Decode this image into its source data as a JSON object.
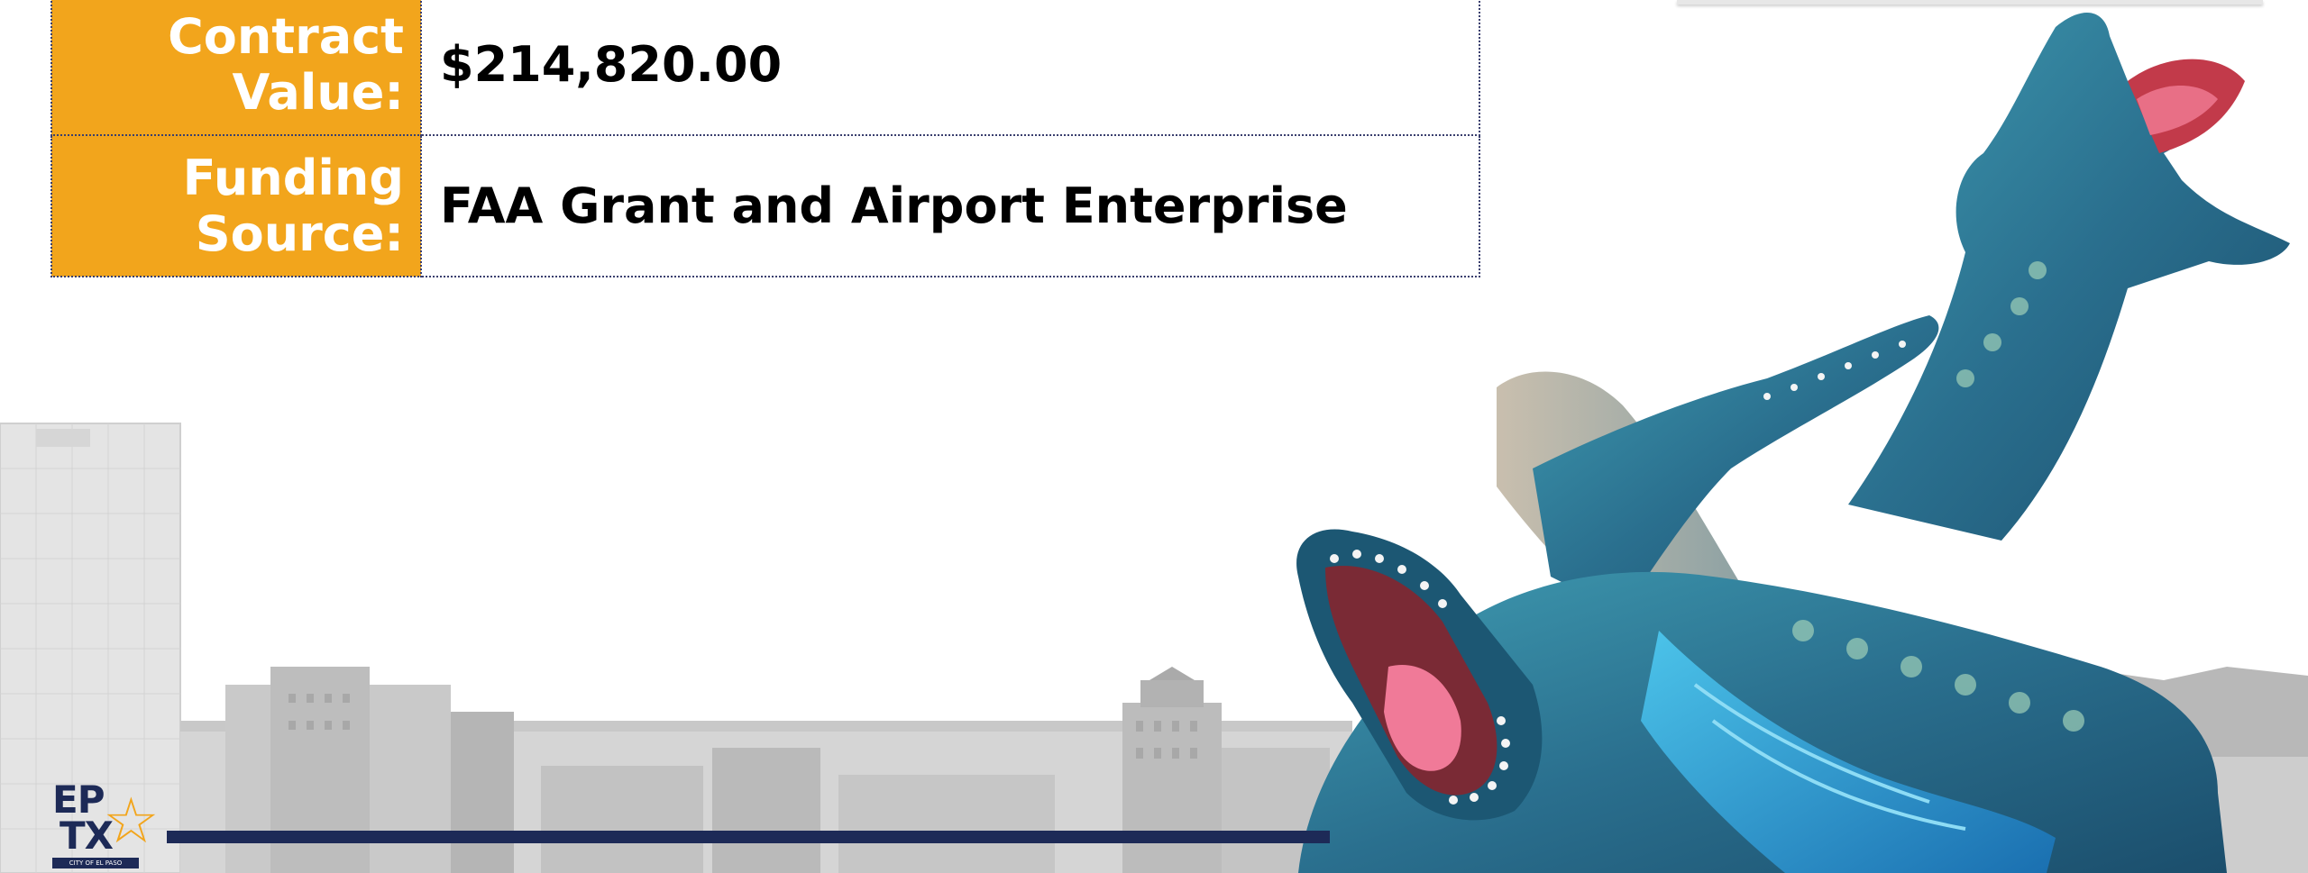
{
  "table": {
    "rows": [
      {
        "label_line1": "Contract",
        "label_line2": "Value:",
        "value": "$214,820.00"
      },
      {
        "label_line1": "Funding",
        "label_line2": "Source:",
        "value": "FAA Grant and Airport Enterprise"
      }
    ]
  },
  "logo": {
    "ep": "EP",
    "tx": "TX",
    "caption": "CITY OF EL PASO",
    "star": "☆"
  },
  "colors": {
    "label_bg": "#f2a51c",
    "navy": "#1d2a57",
    "border": "#3a3f6e"
  }
}
